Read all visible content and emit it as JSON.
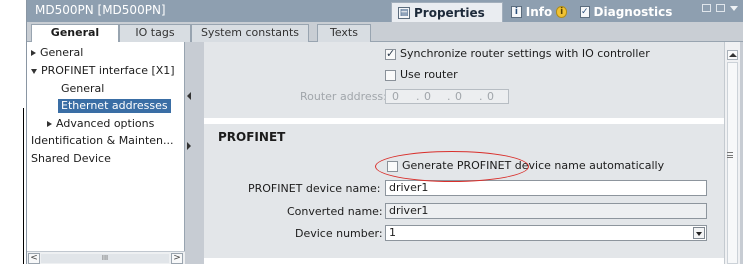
{
  "window": {
    "title": "MD500PN [MD500PN]",
    "top_tabs": [
      {
        "label": "Properties",
        "icon": "properties-icon"
      },
      {
        "label": "Info",
        "icon": "info-icon"
      },
      {
        "label": "Diagnostics",
        "icon": "diagnostics-icon"
      }
    ],
    "info_badge": "i",
    "colors": {
      "titlebar": "#8e9fb0",
      "selection": "#3a6ea5",
      "highlight_ellipse": "#d9302c"
    }
  },
  "tabs": [
    "General",
    "IO tags",
    "System constants",
    "Texts"
  ],
  "nav": {
    "items": [
      {
        "label": "General",
        "expander": "collapsed"
      },
      {
        "label": "PROFINET interface [X1]",
        "expander": "expanded"
      },
      {
        "label": "General",
        "expander": "none"
      },
      {
        "label": "Ethernet addresses",
        "expander": "none",
        "selected": true
      },
      {
        "label": "Advanced options",
        "expander": "collapsed"
      },
      {
        "label": "Identification & Mainten...",
        "expander": "none"
      },
      {
        "label": "Shared Device",
        "expander": "none"
      }
    ],
    "scroll_left": "<",
    "scroll_right": ">",
    "scroll_grip": "III"
  },
  "ip_section": {
    "sync_router_label": "Synchronize router settings with IO controller",
    "sync_router_checked": true,
    "use_router_label": "Use router",
    "use_router_checked": false,
    "router_address_label": "Router address:",
    "router_address_octets": [
      "0",
      "0",
      "0",
      "0"
    ],
    "router_address_sep": "."
  },
  "profinet": {
    "title": "PROFINET",
    "generate_name_label": "Generate PROFINET device name automatically",
    "generate_name_checked": false,
    "device_name_label": "PROFINET device name:",
    "device_name_value": "driver1",
    "converted_name_label": "Converted name:",
    "converted_name_value": "driver1",
    "device_number_label": "Device number:",
    "device_number_value": "1"
  }
}
